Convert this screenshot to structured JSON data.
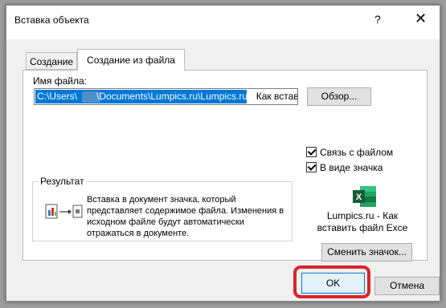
{
  "dialog": {
    "title": "Вставка объекта",
    "help": "?",
    "close": "✕"
  },
  "tabs": [
    {
      "label": "Создание",
      "active": false
    },
    {
      "label": "Создание из файла",
      "active": true
    }
  ],
  "file": {
    "label": "Имя файла:",
    "path_selected": "C:\\Users\\",
    "path_selected2": "\\Documents\\Lumpics.ru\\Lumpics.ru -",
    "path_rest": " Как вставит",
    "browse_label": "Обзор..."
  },
  "options": {
    "link_label": "Связь с файлом",
    "link_checked": true,
    "icon_label": "В виде значка",
    "icon_checked": true
  },
  "result": {
    "legend": "Результат",
    "text": "Вставка в документ значка, который представляет содержимое файла. Изменения в исходном файле будут автоматически отражаться в документе."
  },
  "icon_preview": {
    "icon": "excel-file-icon",
    "label_line1": "Lumpics.ru - Как",
    "label_line2": "вставить файл Exce",
    "change_label": "Сменить значок..."
  },
  "footer": {
    "ok_label": "OK",
    "cancel_label": "Отмена",
    "highlight_color": "#d9242a"
  }
}
